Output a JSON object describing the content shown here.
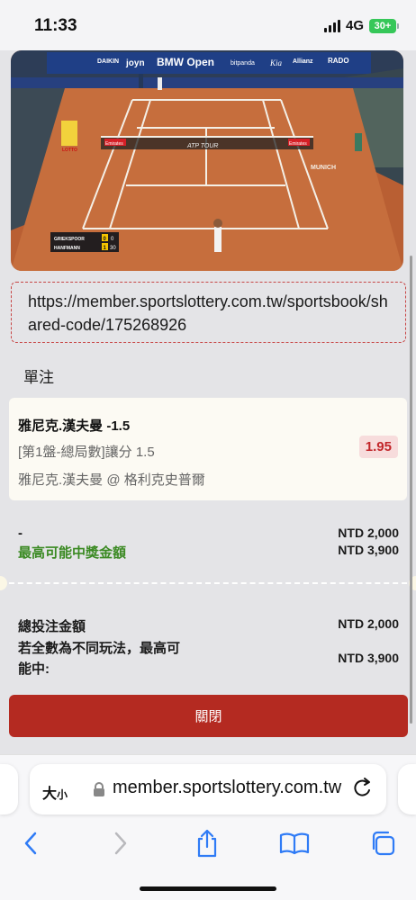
{
  "status_bar": {
    "time": "11:33",
    "network": "4G",
    "battery": "30+"
  },
  "video": {
    "sponsors": [
      "DAIKIN",
      "joyn",
      "BMW Open",
      "bitpanda",
      "Kia",
      "Allianz",
      "RADO"
    ],
    "net_sign_left": "Emirates",
    "net_sign_right": "Emirates",
    "tour_logo": "ATP TOUR",
    "side_logo": "LOTTO",
    "wall_text": "MUNICH",
    "score": {
      "players": [
        {
          "name": "GRIEKSPOOR",
          "sets": "0",
          "games": "0"
        },
        {
          "name": "HANFMANN",
          "sets": "1",
          "games": "30"
        }
      ]
    }
  },
  "share_link": "https://member.sportslottery.com.tw/sportsbook/shared-code/175268926",
  "section_title": "單注",
  "bet": {
    "selection": "雅尼克.漢夫曼 -1.5",
    "market": "[第1盤-總局數]讓分 1.5",
    "match": "雅尼克.漢夫曼 @ 格利克史普爾",
    "odds": "1.95"
  },
  "stake_row": {
    "label": "-",
    "value": "NTD 2,000"
  },
  "max_win_row": {
    "label": "最高可能中獎金額",
    "value": "NTD 3,900"
  },
  "total_stake": {
    "label": "總投注金額",
    "value": "NTD 2,000"
  },
  "max_if_all": {
    "label_line1": "若全數為不同玩法，最高可",
    "label_line2": "能中:",
    "value": "NTD 3,900"
  },
  "close_button": "關閉",
  "browser": {
    "text_size_label": "大",
    "text_size_small": "小",
    "url": "member.sportslottery.com.tw"
  },
  "colors": {
    "accent_red": "#b42a21",
    "odds_red": "#c2262a",
    "win_green": "#3b8a23",
    "clay": "#c0693a"
  }
}
